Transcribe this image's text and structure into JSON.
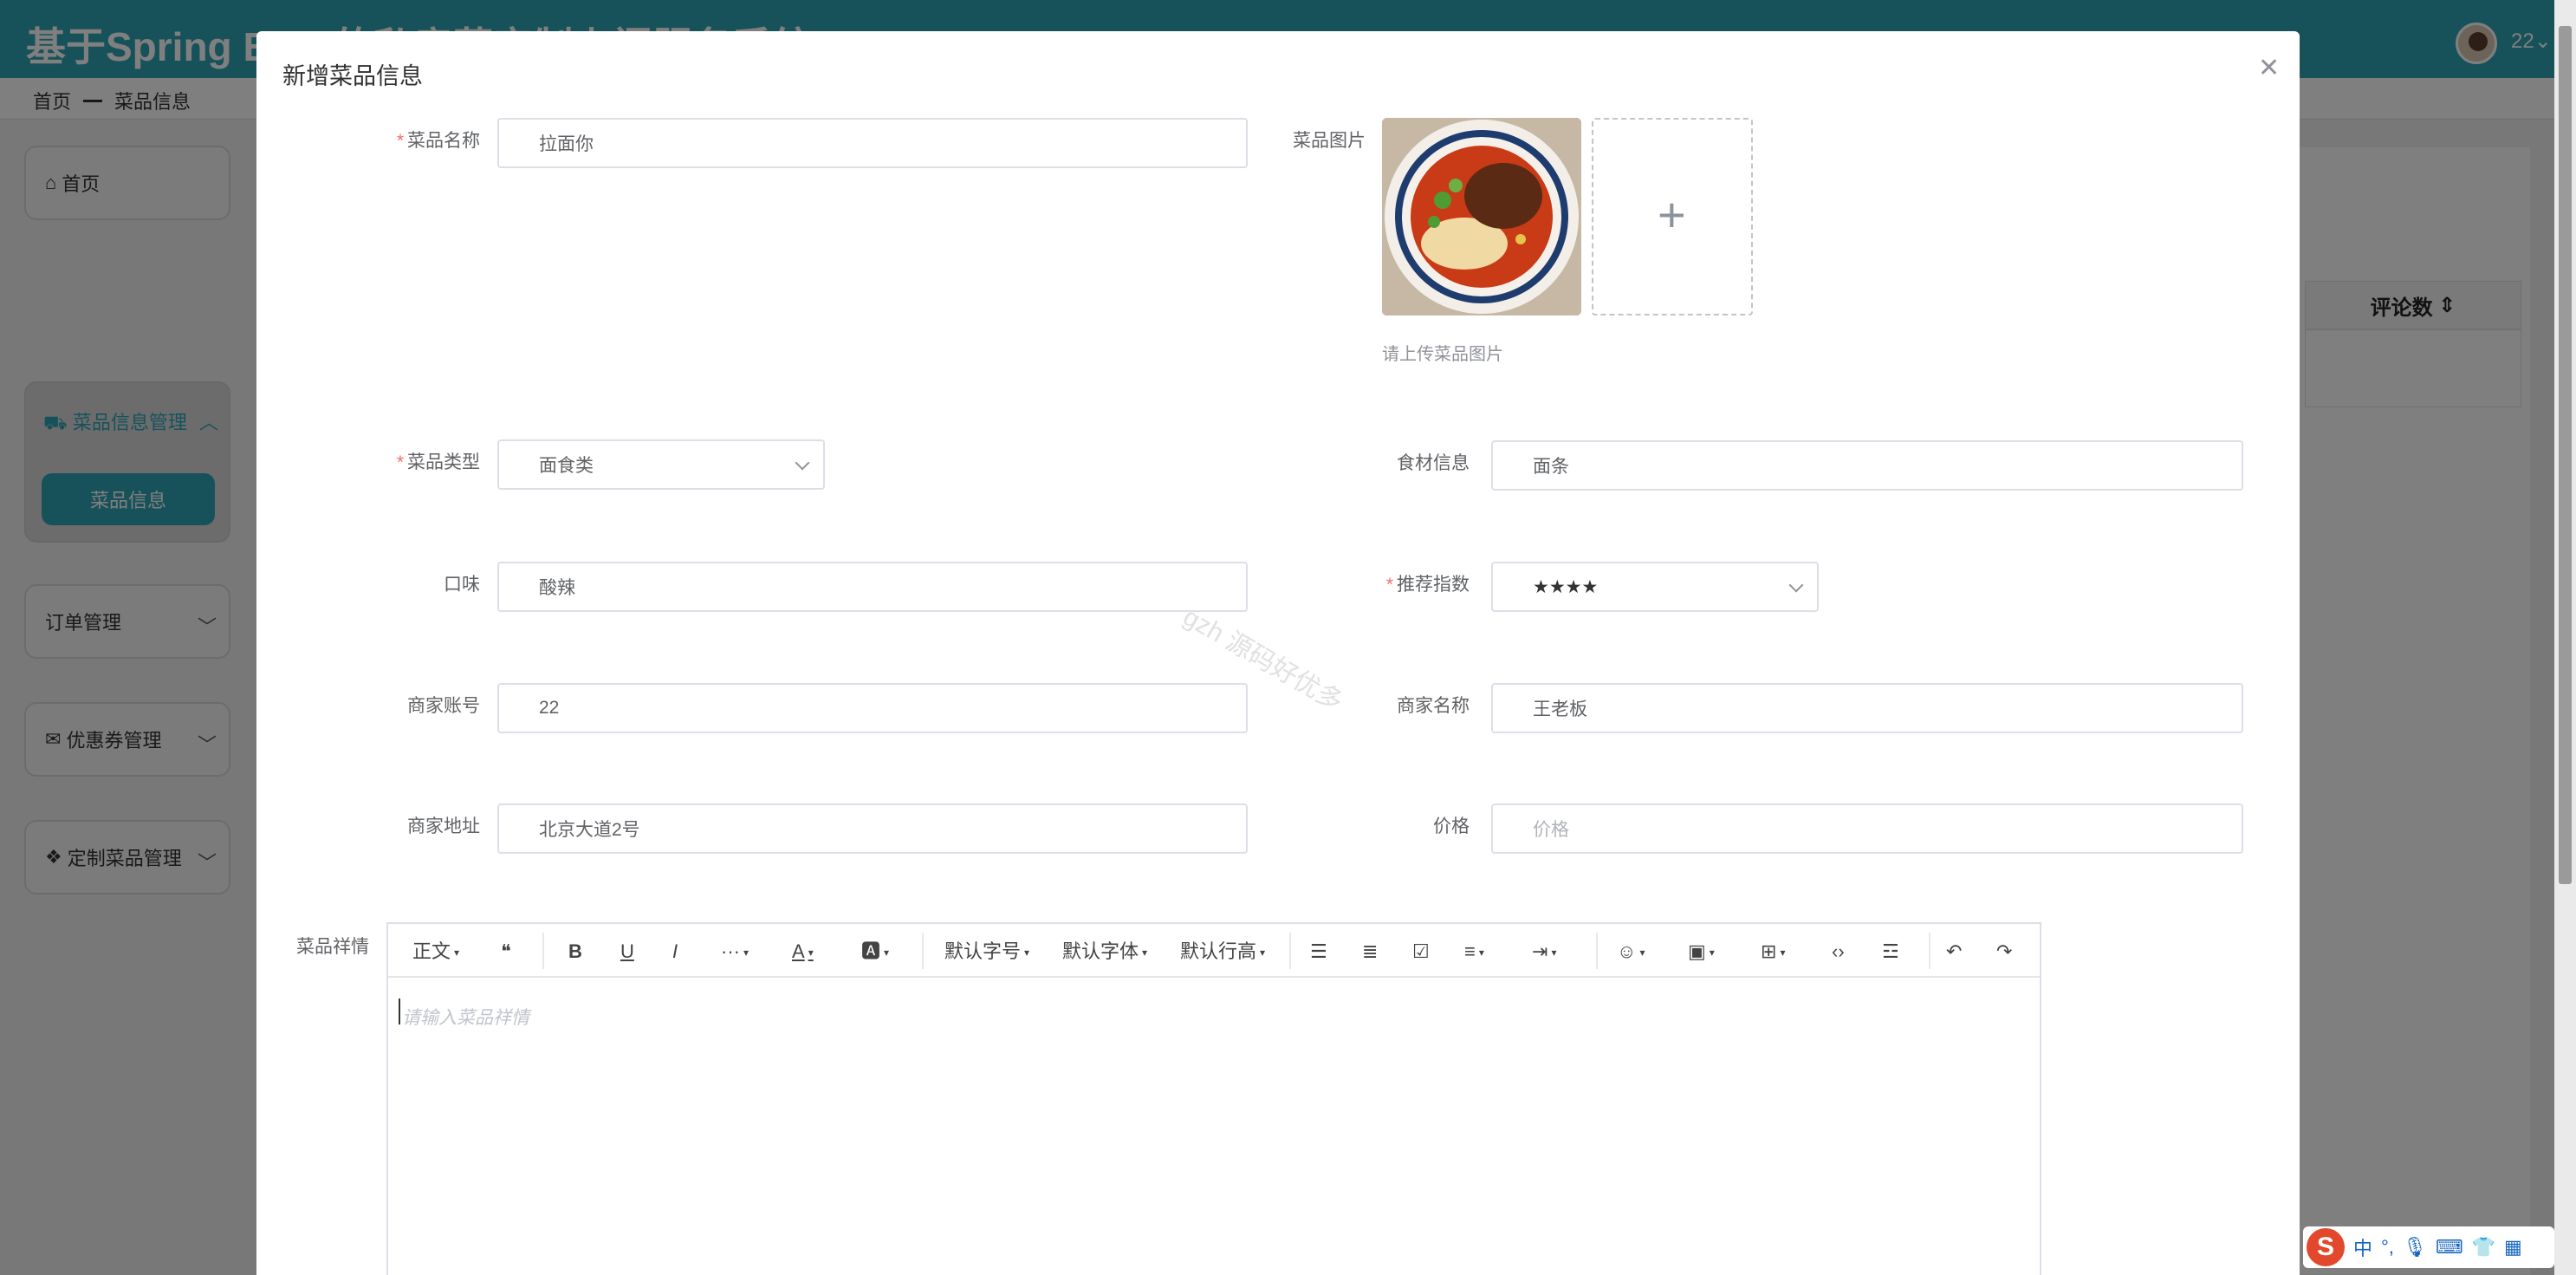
{
  "app": {
    "title": "基于Spring Boot的私房菜定制上门服务系统",
    "user_name": "22"
  },
  "breadcrumb": [
    "首页",
    "菜品信息"
  ],
  "sidebar": {
    "home": "首页",
    "groups": [
      {
        "label": "菜品信息管理",
        "sub": "菜品信息"
      },
      {
        "label": "订单管理"
      },
      {
        "label": "优惠券管理"
      },
      {
        "label": "定制菜品管理"
      }
    ]
  },
  "table": {
    "column_header": "评论数"
  },
  "dialog": {
    "title": "新增菜品信息",
    "fields": {
      "name": {
        "label": "菜品名称",
        "value": "拉面你",
        "required": true
      },
      "image": {
        "label": "菜品图片",
        "tip": "请上传菜品图片"
      },
      "type": {
        "label": "菜品类型",
        "value": "面食类",
        "required": true
      },
      "ingredients": {
        "label": "食材信息",
        "value": "面条"
      },
      "taste": {
        "label": "口味",
        "value": "酸辣"
      },
      "recommend": {
        "label": "推荐指数",
        "value": "★★★★",
        "required": true
      },
      "merchant_account": {
        "label": "商家账号",
        "value": "22"
      },
      "merchant_name": {
        "label": "商家名称",
        "value": "王老板"
      },
      "merchant_address": {
        "label": "商家地址",
        "value": "北京大道2号"
      },
      "price": {
        "label": "价格",
        "placeholder": "价格"
      },
      "detail": {
        "label": "菜品祥情",
        "placeholder": "请输入菜品祥情"
      }
    },
    "required_mark": "*"
  },
  "editor_toolbar": {
    "paragraph": "正文",
    "font_size": "默认字号",
    "font_family": "默认字体",
    "line_height": "默认行高"
  },
  "watermark": "gzh 源码好优多",
  "ime": {
    "mode": "中",
    "punct": "°,"
  }
}
